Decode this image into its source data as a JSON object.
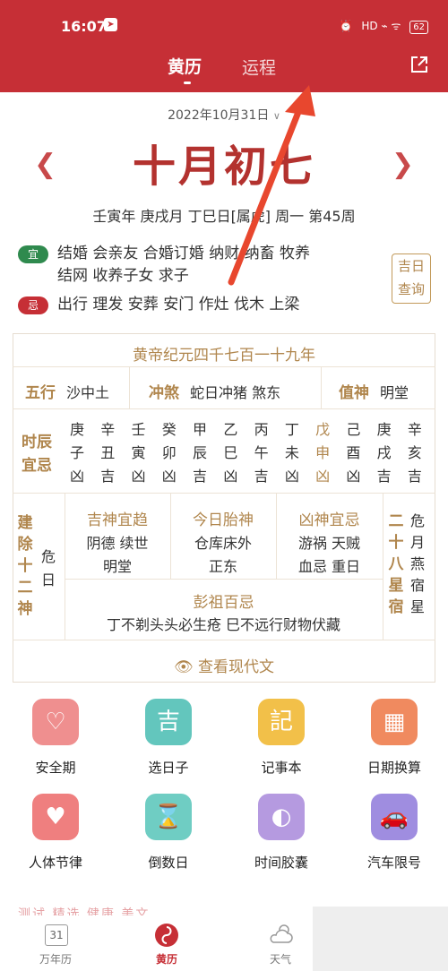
{
  "status": {
    "time": "16:07",
    "battery": "62",
    "signal": "HD ⌁ ᯤ"
  },
  "tabs": {
    "huangli": "黄历",
    "yuncheng": "运程"
  },
  "date": {
    "solar": "2022年10月31日",
    "lunar": "十月初七",
    "ganzhi": "壬寅年 庚戌月 丁巳日[属虎] 周一 第45周"
  },
  "yi": {
    "badge": "宜",
    "line1": "结婚 会亲友 合婚订婚 纳财 纳畜 牧养",
    "line2": "结网 收养子女 求子"
  },
  "ji": {
    "badge": "忌",
    "line1": "出行 理发 安葬 安门 作灶 伐木 上梁"
  },
  "jiri_button": {
    "l1": "吉日",
    "l2": "查询"
  },
  "almanac": {
    "era": "黄帝纪元四千七百一十九年",
    "wuxing_label": "五行",
    "wuxing_value": "沙中土",
    "chongsha_label": "冲煞",
    "chongsha_value": "蛇日冲猪 煞东",
    "zhishen_label": "值神",
    "zhishen_value": "明堂",
    "shichen_label1": "时辰",
    "shichen_label2": "宜忌",
    "hours": [
      {
        "g": "庚",
        "z": "子",
        "j": "凶"
      },
      {
        "g": "辛",
        "z": "丑",
        "j": "吉"
      },
      {
        "g": "壬",
        "z": "寅",
        "j": "凶"
      },
      {
        "g": "癸",
        "z": "卯",
        "j": "凶"
      },
      {
        "g": "甲",
        "z": "辰",
        "j": "吉"
      },
      {
        "g": "乙",
        "z": "巳",
        "j": "凶"
      },
      {
        "g": "丙",
        "z": "午",
        "j": "吉"
      },
      {
        "g": "丁",
        "z": "未",
        "j": "凶"
      },
      {
        "g": "戊",
        "z": "申",
        "j": "凶"
      },
      {
        "g": "己",
        "z": "酉",
        "j": "凶"
      },
      {
        "g": "庚",
        "z": "戌",
        "j": "吉"
      },
      {
        "g": "辛",
        "z": "亥",
        "j": "吉"
      }
    ],
    "jianchu_label": [
      "建",
      "除",
      "十",
      "二",
      "神"
    ],
    "jianchu_value": [
      "危",
      "日"
    ],
    "jishen_label": "吉神宜趋",
    "jishen_l1": "阴德 续世",
    "jishen_l2": "明堂",
    "taishen_label": "今日胎神",
    "taishen_l1": "仓库床外",
    "taishen_l2": "正东",
    "xiongshen_label": "凶神宜忌",
    "xiongshen_l1": "游祸 天贼",
    "xiongshen_l2": "血忌 重日",
    "xingsu_label": [
      "二",
      "十",
      "八",
      "星",
      "宿"
    ],
    "xingsu_value": [
      "危",
      "月",
      "燕",
      "宿",
      "星"
    ],
    "pengzu_label": "彭祖百忌",
    "pengzu_value": "丁不剃头头必生疮 巳不远行财物伏藏",
    "modern": "查看现代文"
  },
  "tools": [
    {
      "label": "安全期",
      "color": "#ef8f8f"
    },
    {
      "label": "选日子",
      "color": "#63c6bd"
    },
    {
      "label": "记事本",
      "color": "#f2c049"
    },
    {
      "label": "日期换算",
      "color": "#f08a5f"
    },
    {
      "label": "人体节律",
      "color": "#ef7f7f"
    },
    {
      "label": "倒数日",
      "color": "#6fcdc3"
    },
    {
      "label": "时间胶囊",
      "color": "#b59ae0"
    },
    {
      "label": "汽车限号",
      "color": "#9f8de0"
    }
  ],
  "bottom_nav": {
    "calendar_num": "31",
    "wannianli": "万年历",
    "huangli": "黄历",
    "tianqi": "天气",
    "partial": "测试  精选  健康  美文"
  }
}
